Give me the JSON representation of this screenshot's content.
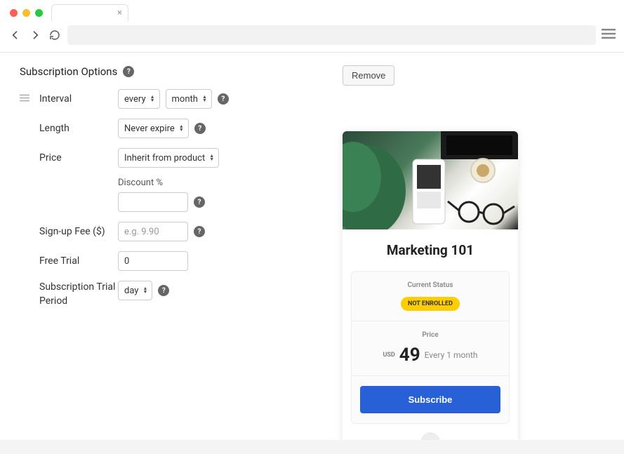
{
  "form": {
    "title": "Subscription Options",
    "rows": {
      "interval": {
        "label": "Interval",
        "frequency": "every",
        "unit": "month"
      },
      "length": {
        "label": "Length",
        "value": "Never expire"
      },
      "price": {
        "label": "Price",
        "value": "Inherit from product"
      },
      "discount": {
        "label": "Discount %",
        "value": ""
      },
      "signup_fee": {
        "label": "Sign-up Fee ($)",
        "placeholder": "e.g. 9.90",
        "value": ""
      },
      "free_trial": {
        "label": "Free Trial",
        "value": "0"
      },
      "trial_period": {
        "label": "Subscription Trial Period",
        "value": "day"
      }
    }
  },
  "actions": {
    "remove": "Remove"
  },
  "preview": {
    "title": "Marketing 101",
    "status_label": "Current Status",
    "status_badge": "NOT ENROLLED",
    "price_label": "Price",
    "currency": "USD",
    "amount": "49",
    "period": "Every 1 month",
    "cta": "Subscribe"
  }
}
